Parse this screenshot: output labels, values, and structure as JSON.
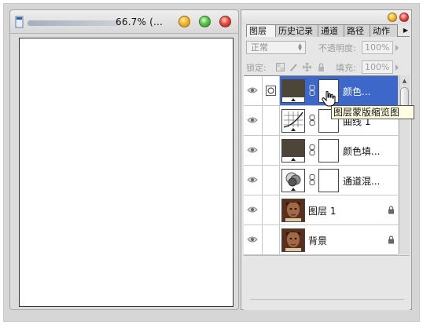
{
  "document": {
    "zoom_title": "66.7% (...",
    "traffic_lights": [
      "minimize",
      "zoom",
      "close"
    ]
  },
  "layers_panel": {
    "tabs": [
      {
        "label": "图层",
        "active": true
      },
      {
        "label": "历史记录",
        "active": false
      },
      {
        "label": "通道",
        "active": false
      },
      {
        "label": "路径",
        "active": false
      },
      {
        "label": "动作",
        "active": false
      }
    ],
    "tab_more_glyph": "▶",
    "blend_mode": "正常",
    "opacity_label": "不透明度:",
    "opacity_value": "100%",
    "lock_label": "锁定:",
    "fill_label": "填充:",
    "fill_value": "100%",
    "layers": [
      {
        "name": "颜色...",
        "thumb": "solid-dark",
        "has_mask": true,
        "selected": true,
        "locked": false,
        "link_icon": "adjustment-icon"
      },
      {
        "name": "曲线 1",
        "thumb": "curves",
        "has_mask": true,
        "selected": false,
        "locked": false,
        "link_icon": ""
      },
      {
        "name": "颜色填...",
        "thumb": "solid-dark",
        "has_mask": true,
        "selected": false,
        "locked": false,
        "link_icon": ""
      },
      {
        "name": "通道混...",
        "thumb": "channel-mixer",
        "has_mask": true,
        "selected": false,
        "locked": false,
        "link_icon": ""
      },
      {
        "name": "图层 1",
        "thumb": "portrait",
        "has_mask": false,
        "selected": false,
        "locked": true,
        "link_icon": ""
      },
      {
        "name": "背景",
        "thumb": "portrait",
        "has_mask": false,
        "selected": false,
        "locked": true,
        "link_icon": ""
      }
    ]
  },
  "tooltip": {
    "text": "图层蒙版缩览图"
  },
  "colors": {
    "selection": "#3d67c9",
    "solid_fill_thumb": "#4d4538",
    "tooltip_bg": "#ffffe1"
  }
}
